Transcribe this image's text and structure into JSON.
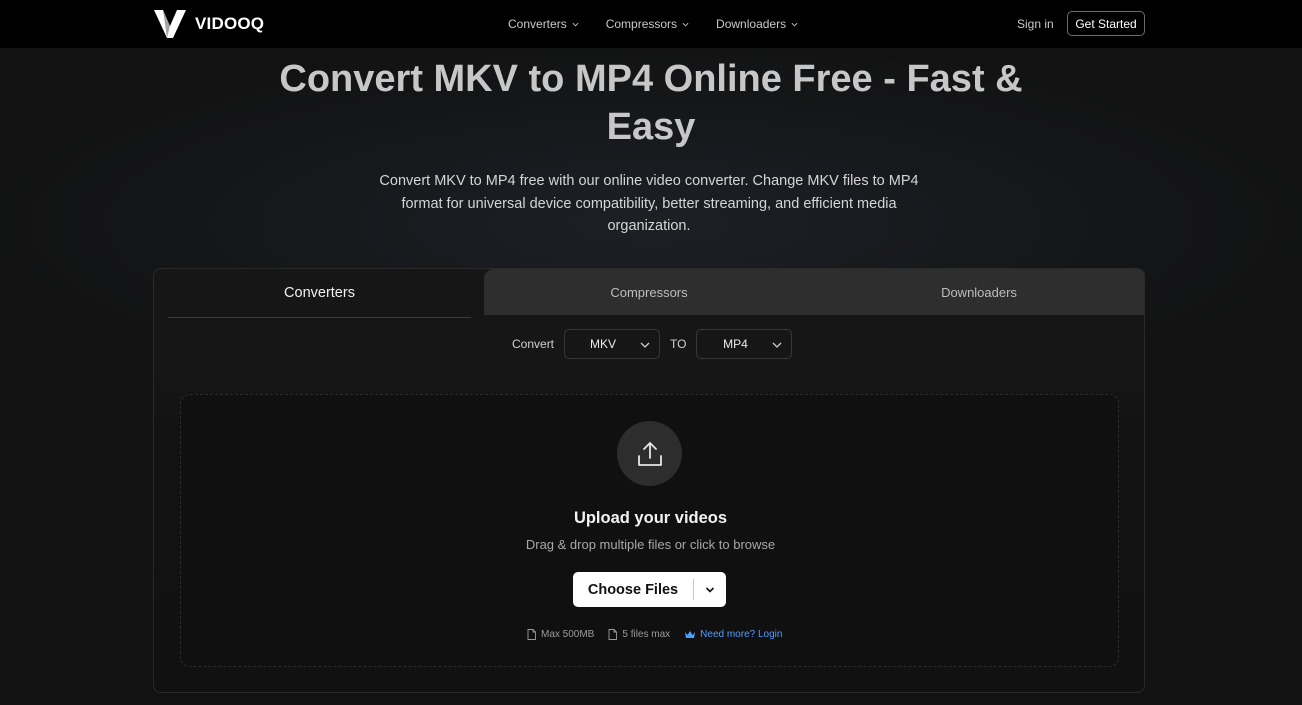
{
  "brand": {
    "name": "VIDOOQ"
  },
  "nav": {
    "items": [
      {
        "label": "Converters"
      },
      {
        "label": "Compressors"
      },
      {
        "label": "Downloaders"
      }
    ],
    "sign_in": "Sign in",
    "get_started": "Get Started"
  },
  "hero": {
    "title": "Convert MKV to MP4 Online Free - Fast & Easy",
    "description": "Convert MKV to MP4 free with our online video converter. Change MKV files to MP4 format for universal device compatibility, better streaming, and efficient media organization."
  },
  "tabs": [
    {
      "label": "Converters",
      "active": true
    },
    {
      "label": "Compressors",
      "active": false
    },
    {
      "label": "Downloaders",
      "active": false
    }
  ],
  "converter": {
    "convert_label": "Convert",
    "from_format": "MKV",
    "to_label": "TO",
    "to_format": "MP4"
  },
  "upload": {
    "title": "Upload your videos",
    "subtitle": "Drag & drop multiple files or click to browse",
    "button": "Choose Files",
    "max_size": "Max 500MB",
    "max_files": "5 files max",
    "need_more": "Need more? Login"
  },
  "colors": {
    "background": "#121212",
    "nav_bg": "#000000",
    "link": "#4d9fff",
    "button_bg": "#ffffff"
  },
  "icons": {
    "logo": "vidooq-logo-icon",
    "upload": "upload-icon",
    "file": "file-icon",
    "crown": "crown-icon",
    "chevron": "chevron-down-icon"
  }
}
